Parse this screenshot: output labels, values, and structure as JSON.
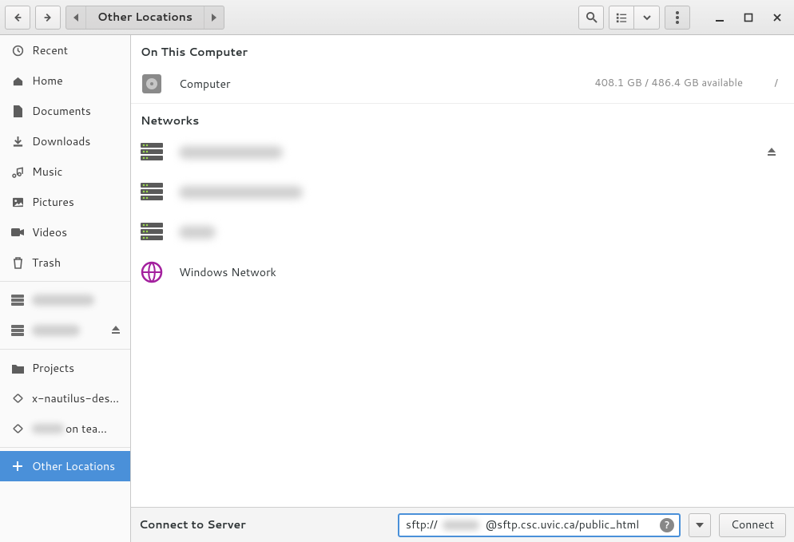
{
  "titlebar": {
    "location_label": "Other Locations"
  },
  "sidebar": {
    "places": [
      {
        "key": "recent",
        "label": "Recent",
        "icon": "clock-icon"
      },
      {
        "key": "home",
        "label": "Home",
        "icon": "home-icon"
      },
      {
        "key": "documents",
        "label": "Documents",
        "icon": "document-icon"
      },
      {
        "key": "downloads",
        "label": "Downloads",
        "icon": "download-icon"
      },
      {
        "key": "music",
        "label": "Music",
        "icon": "music-icon"
      },
      {
        "key": "pictures",
        "label": "Pictures",
        "icon": "pictures-icon"
      },
      {
        "key": "videos",
        "label": "Videos",
        "icon": "videos-icon"
      },
      {
        "key": "trash",
        "label": "Trash",
        "icon": "trash-icon"
      }
    ],
    "mounts": [
      {
        "label": "(redacted)",
        "redacted": true,
        "eject": false
      },
      {
        "label": "(redacted)",
        "redacted": true,
        "eject": true
      }
    ],
    "bookmarks": [
      {
        "label": "Projects",
        "icon": "folder-icon"
      },
      {
        "label": "x-nautilus-des…",
        "icon": "link-icon"
      },
      {
        "label_prefix": "",
        "label_suffix": " on tea…",
        "redacted_middle": true,
        "icon": "link-icon"
      }
    ],
    "other_locations_label": "Other Locations"
  },
  "main": {
    "section_on_computer": "On This Computer",
    "computer": {
      "name": "Computer",
      "storage": "408.1 GB  /  486.4 GB available",
      "mount": "/"
    },
    "section_networks": "Networks",
    "networks": [
      {
        "name": "(redacted)",
        "redacted": true,
        "blur_width": 130,
        "eject": true
      },
      {
        "name": "(redacted)",
        "redacted": true,
        "blur_width": 155,
        "eject": false
      },
      {
        "name": "(redacted)",
        "redacted": true,
        "blur_width": 46,
        "eject": false
      }
    ],
    "windows_network_label": "Windows Network"
  },
  "connect": {
    "label": "Connect to Server",
    "url_prefix": "sftp://",
    "url_suffix": "@sftp.csc.uvic.ca/public_html",
    "button": "Connect"
  }
}
